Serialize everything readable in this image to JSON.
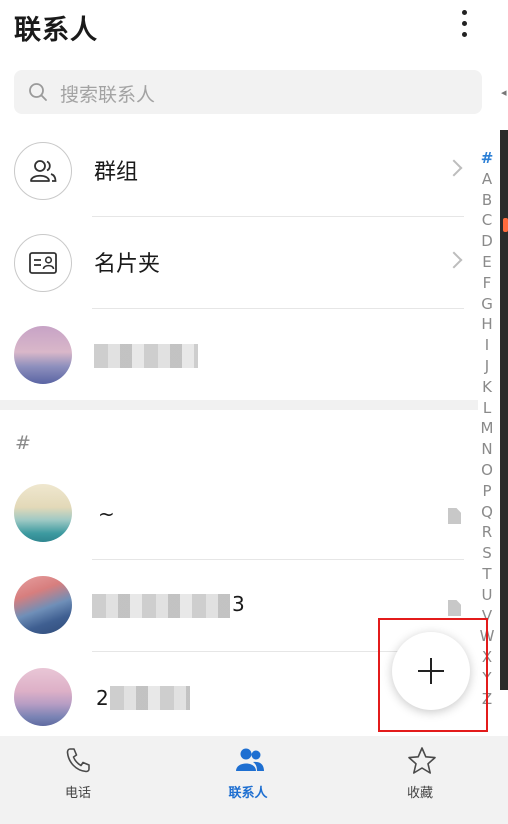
{
  "header": {
    "title": "联系人",
    "more_icon": "more-vertical-icon"
  },
  "search": {
    "placeholder": "搜索联系人",
    "icon": "search-icon"
  },
  "rows": {
    "groups": {
      "label": "群组",
      "icon": "groups-icon"
    },
    "cards": {
      "label": "名片夹",
      "icon": "business-card-icon"
    }
  },
  "section": {
    "header": "#"
  },
  "contacts": [
    {
      "name": "~"
    },
    {
      "name": "3"
    },
    {
      "name": "2"
    }
  ],
  "index": [
    "#",
    "A",
    "B",
    "C",
    "D",
    "E",
    "F",
    "G",
    "H",
    "I",
    "J",
    "K",
    "L",
    "M",
    "N",
    "O",
    "P",
    "Q",
    "R",
    "S",
    "T",
    "U",
    "V",
    "W",
    "X",
    "Y",
    "Z"
  ],
  "fab": {
    "icon": "plus-icon"
  },
  "nav": {
    "tabs": [
      {
        "label": "电话",
        "icon": "phone-icon"
      },
      {
        "label": "联系人",
        "icon": "contacts-icon"
      },
      {
        "label": "收藏",
        "icon": "star-icon"
      }
    ]
  },
  "colors": {
    "accent": "#1e6fd1",
    "highlight": "#e31b1b"
  }
}
